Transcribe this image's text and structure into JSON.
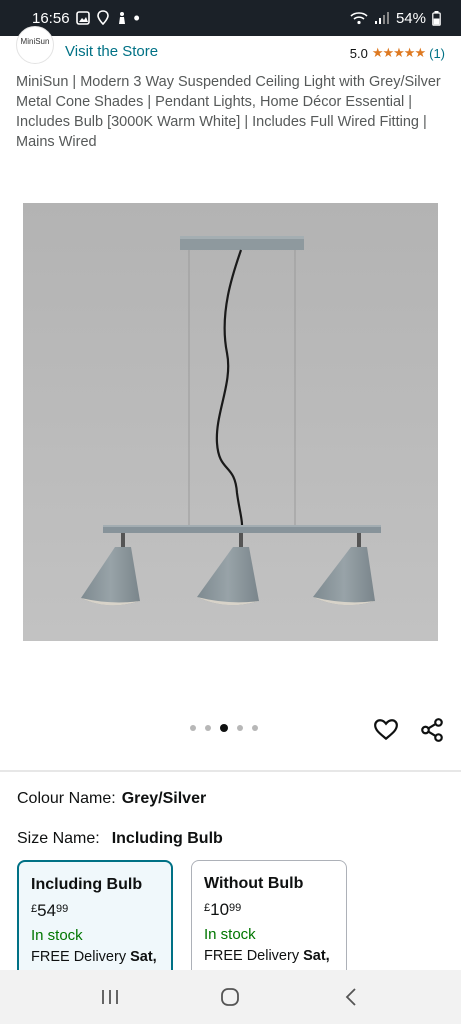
{
  "status_bar": {
    "time": "16:56",
    "battery": "54%"
  },
  "store": {
    "logo_text": "MiniSun",
    "visit_label": "Visit the Store",
    "rating_value": "5.0",
    "stars": "★★★★★",
    "rating_count": "(1)"
  },
  "product": {
    "title": "MiniSun | Modern 3 Way Suspended Ceiling Light with Grey/Silver Metal Cone Shades | Pendant Lights, Home Décor Essential | Includes Bulb [3000K Warm White] | Includes Full Wired Fitting | Mains Wired"
  },
  "gallery": {
    "image_count": 5,
    "active_index": 2
  },
  "attributes": {
    "colour_label": "Colour Name:",
    "colour_value": "Grey/Silver",
    "size_label": "Size Name:",
    "size_value": "Including Bulb"
  },
  "options": [
    {
      "title": "Including Bulb",
      "currency": "£",
      "price_whole": "54",
      "price_fraction": "99",
      "stock": "In stock",
      "delivery_prefix": "FREE Delivery ",
      "delivery_day": "Sat,"
    },
    {
      "title": "Without Bulb",
      "currency": "£",
      "price_whole": "10",
      "price_fraction": "99",
      "stock": "In stock",
      "delivery_prefix": "FREE Delivery ",
      "delivery_day": "Sat,"
    }
  ],
  "colors": {
    "link": "#007185",
    "star": "#de7921",
    "in_stock": "#007600",
    "selected_border": "#007185"
  }
}
